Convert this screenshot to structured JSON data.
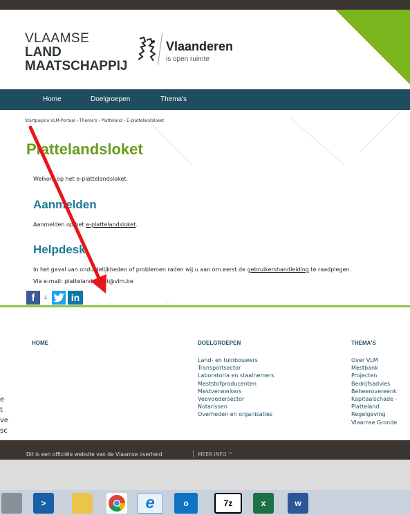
{
  "header": {
    "logo_line1": "VLAAMSE",
    "logo_line2": "LAND",
    "logo_line3": "MAATSCHAPPIJ",
    "brand_name": "Vlaanderen",
    "brand_tagline": "is open ruimte"
  },
  "nav": {
    "items": [
      "Home",
      "Doelgroepen",
      "Thema's"
    ]
  },
  "breadcrumb": "Startpagina VLM-Portaal › Thema's › Platteland › E-plattelandsloket",
  "main": {
    "title": "Plattelandsloket",
    "intro": "Welkom op het e-plattelandsloket.",
    "aanmelden_heading": "Aanmelden",
    "aanmelden_prefix": "Aanmelden op het ",
    "aanmelden_link": "e-plattelandsloket",
    "aanmelden_suffix": ".",
    "helpdesk_heading": "Helpdesk",
    "helpdesk_line1_prefix": "In het geval van onduidelijkheden of problemen raden wij u aan om eerst de ",
    "helpdesk_line1_link": "gebruikershandleiding",
    "helpdesk_line1_suffix": " te raadplegen.",
    "helpdesk_line2": "Via e-mail: plattelandsloket@vlm.be"
  },
  "social": {
    "facebook_glyph": "f",
    "facebook_count": "1",
    "linkedin_glyph": "in"
  },
  "footer": {
    "home_heading": "HOME",
    "doelgroepen_heading": "DOELGROEPEN",
    "doelgroepen_items": [
      "Land- en tuinbouwers",
      "Transportsector",
      "Laboratoria en staalnemers",
      "Meststofproducenten",
      "Mestverwerkers",
      "Veevoedersector",
      "Notarissen",
      "Overheden en organisaties"
    ],
    "themas_heading": "THEMA'S",
    "themas_items": [
      "Over VLM",
      "Mestbank",
      "Projecten",
      "Bedrijfsadvies",
      "Beheerovereenk",
      "Kapitaalschade -",
      "Platteland",
      "Regelgeving",
      "Vlaamse Gronde"
    ],
    "official_text": "Dit is een officiële website van de Vlaamse overheid",
    "meer_info": "MEER INFO ^"
  },
  "left_fragment": [
    "e",
    "t",
    "ve",
    "sc"
  ],
  "taskbar": {
    "apps": [
      "powershell-icon",
      "file-explorer-icon",
      "chrome-icon",
      "internet-explorer-icon",
      "outlook-icon",
      "7zip-icon",
      "excel-icon",
      "word-icon"
    ],
    "labels": {
      "outlook": "o",
      "sevenzip": "7z",
      "excel": "x",
      "word": "w"
    }
  },
  "colors": {
    "nav_bg": "#1e4d5f",
    "title_green": "#6b9a1d",
    "heading_blue": "#1e7a99",
    "accent_green": "#7ab51d",
    "annotation_arrow": "#e8161b"
  }
}
